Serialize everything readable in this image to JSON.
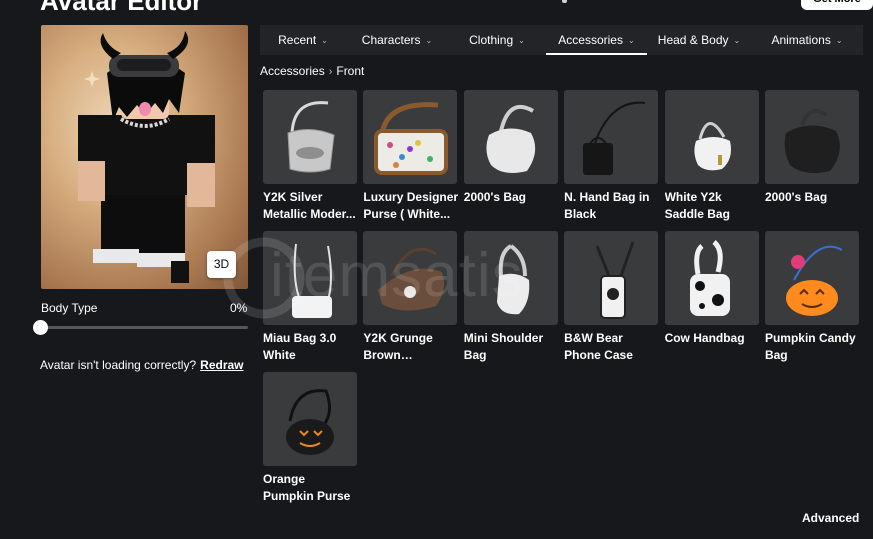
{
  "page": {
    "title": "Avatar Editor",
    "top_button": "Get More"
  },
  "avatar": {
    "view_button": "3D",
    "body_type_label": "Body Type",
    "body_type_value": "0%",
    "body_type_level": 0,
    "loading_note": "Avatar isn't loading correctly?",
    "redraw_label": "Redraw"
  },
  "tabs": [
    {
      "label": "Recent",
      "active": false
    },
    {
      "label": "Characters",
      "active": false
    },
    {
      "label": "Clothing",
      "active": false
    },
    {
      "label": "Accessories",
      "active": true
    },
    {
      "label": "Head & Body",
      "active": false
    },
    {
      "label": "Animations",
      "active": false
    }
  ],
  "breadcrumb": {
    "parent": "Accessories",
    "current": "Front"
  },
  "items": [
    {
      "name": "Y2K Silver Metallic Moder..."
    },
    {
      "name": "Luxury Designer Purse ( White..."
    },
    {
      "name": "2000's Bag"
    },
    {
      "name": "N. Hand Bag in Black"
    },
    {
      "name": "White Y2k Saddle Bag"
    },
    {
      "name": "2000's Bag"
    },
    {
      "name": "Miau Bag 3.0 White"
    },
    {
      "name": "Y2K Grunge Brown Shoulde..."
    },
    {
      "name": "Mini Shoulder Bag"
    },
    {
      "name": "B&W Bear Phone Case"
    },
    {
      "name": "Cow Handbag"
    },
    {
      "name": "Pumpkin Candy Bag"
    },
    {
      "name": "Orange Pumpkin Purse"
    }
  ],
  "watermark": "itemsatis",
  "footer": {
    "advanced_label": "Advanced"
  }
}
